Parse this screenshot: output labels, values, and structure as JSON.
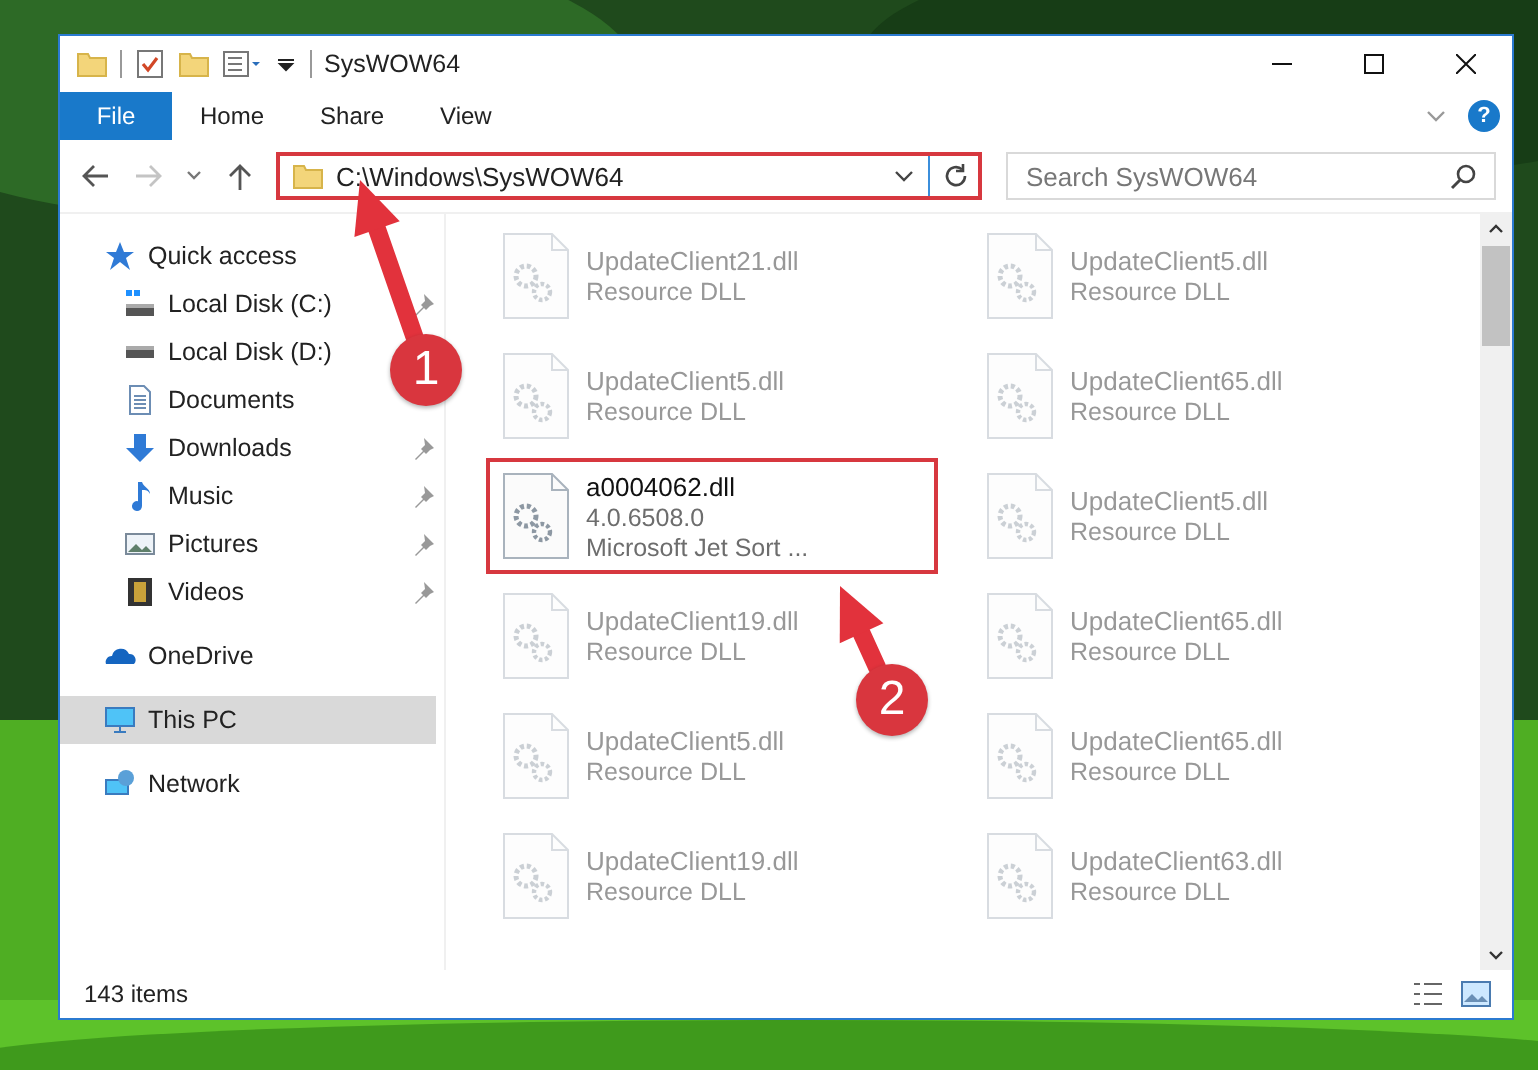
{
  "window": {
    "title": "SysWOW64"
  },
  "ribbon": {
    "tabs": [
      {
        "label": "File",
        "kind": "menu"
      },
      {
        "label": "Home",
        "kind": "tab"
      },
      {
        "label": "Share",
        "kind": "tab"
      },
      {
        "label": "View",
        "kind": "tab"
      }
    ],
    "help": "?"
  },
  "toolbar": {
    "forward_enabled": false
  },
  "address_bar": {
    "path": "C:\\Windows\\SysWOW64",
    "highlighted": true
  },
  "search": {
    "placeholder": "Search SysWOW64"
  },
  "navigation": [
    {
      "label": "Quick access",
      "kind": "star",
      "selected": false,
      "children": [
        {
          "label": "Local Disk (C:)",
          "kind": "sysdrive",
          "pinned": true,
          "selected": false
        },
        {
          "label": "Local Disk (D:)",
          "kind": "drive",
          "pinned": false,
          "selected": false
        },
        {
          "label": "Documents",
          "kind": "docs",
          "pinned": false,
          "selected": false
        },
        {
          "label": "Downloads",
          "kind": "download",
          "pinned": true,
          "selected": false
        },
        {
          "label": "Music",
          "kind": "music",
          "pinned": true,
          "selected": false
        },
        {
          "label": "Pictures",
          "kind": "pictures",
          "pinned": true,
          "selected": false
        },
        {
          "label": "Videos",
          "kind": "videos",
          "pinned": true,
          "selected": false
        }
      ]
    },
    {
      "label": "OneDrive",
      "kind": "cloud",
      "selected": false
    },
    {
      "label": "This PC",
      "kind": "pc",
      "selected": true
    },
    {
      "label": "Network",
      "kind": "network",
      "selected": false
    }
  ],
  "files": [
    {
      "name": "UpdateClient21.dll",
      "details": [
        "Resource DLL"
      ],
      "blurred": true,
      "highlighted": false
    },
    {
      "name": "UpdateClient5.dll",
      "details": [
        "Resource DLL"
      ],
      "blurred": true,
      "highlighted": false
    },
    {
      "name": "UpdateClient5.dll",
      "details": [
        "Resource DLL"
      ],
      "blurred": true,
      "highlighted": false
    },
    {
      "name": "UpdateClient65.dll",
      "details": [
        "Resource DLL"
      ],
      "blurred": true,
      "highlighted": false
    },
    {
      "name": "a0004062.dll",
      "details": [
        "4.0.6508.0",
        "Microsoft Jet Sort ..."
      ],
      "blurred": false,
      "highlighted": true
    },
    {
      "name": "UpdateClient5.dll",
      "details": [
        "Resource DLL"
      ],
      "blurred": true,
      "highlighted": false
    },
    {
      "name": "UpdateClient19.dll",
      "details": [
        "Resource DLL"
      ],
      "blurred": true,
      "highlighted": false
    },
    {
      "name": "UpdateClient65.dll",
      "details": [
        "Resource DLL"
      ],
      "blurred": true,
      "highlighted": false
    },
    {
      "name": "UpdateClient5.dll",
      "details": [
        "Resource DLL"
      ],
      "blurred": true,
      "highlighted": false
    },
    {
      "name": "UpdateClient65.dll",
      "details": [
        "Resource DLL"
      ],
      "blurred": true,
      "highlighted": false
    },
    {
      "name": "UpdateClient19.dll",
      "details": [
        "Resource DLL"
      ],
      "blurred": true,
      "highlighted": false
    },
    {
      "name": "UpdateClient63.dll",
      "details": [
        "Resource DLL"
      ],
      "blurred": true,
      "highlighted": false
    }
  ],
  "status_bar": {
    "item_count": "143 items"
  },
  "annotations": [
    {
      "number": "1"
    },
    {
      "number": "2"
    }
  ]
}
